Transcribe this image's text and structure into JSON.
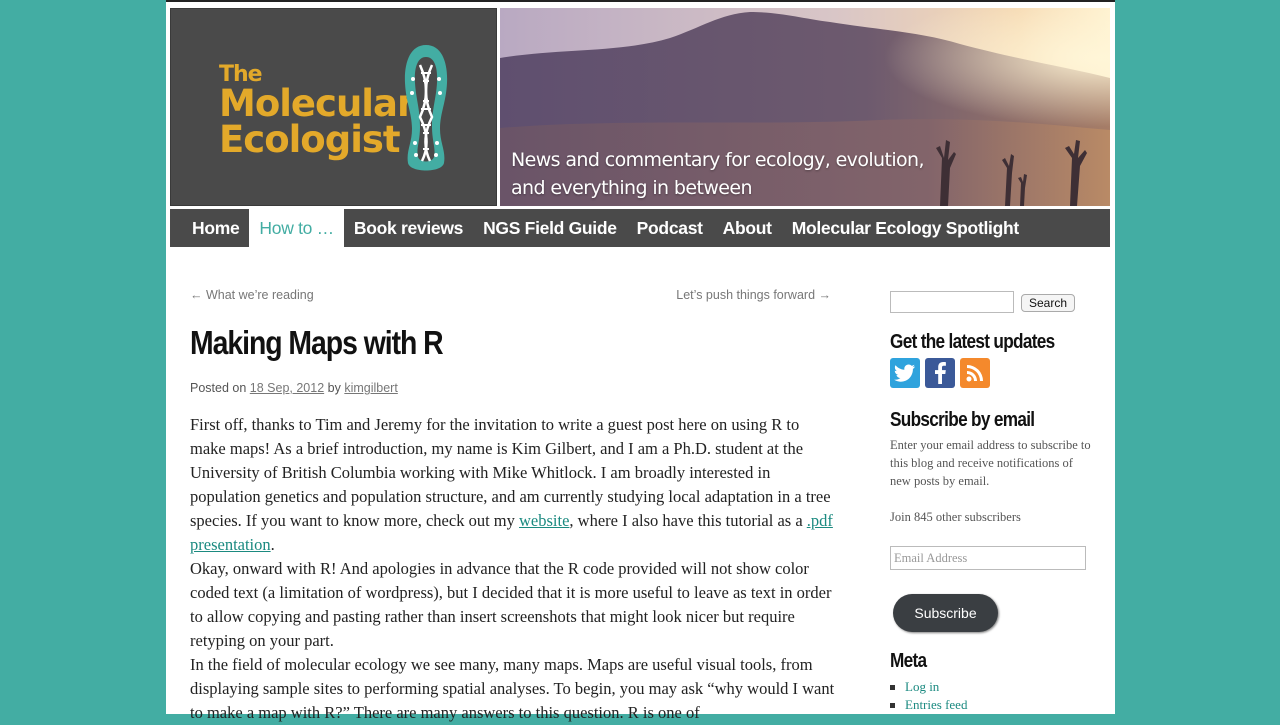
{
  "site": {
    "logo_line1": "The",
    "logo_line2": "Molecular",
    "logo_line3": "Ecologist",
    "tagline_line1": "News and commentary for ecology, evolution,",
    "tagline_line2": "and everything in between"
  },
  "nav": {
    "items": [
      "Home",
      "How to …",
      "Book reviews",
      "NGS Field Guide",
      "Podcast",
      "About",
      "Molecular Ecology Spotlight"
    ],
    "active": "How to …"
  },
  "post_nav": {
    "prev": "← What we’re reading",
    "next": "Let’s push things forward →"
  },
  "post": {
    "title": "Making Maps with R",
    "posted_on": "Posted on",
    "date": "18 Sep, 2012",
    "by": "by",
    "author": "kimgilbert",
    "p1_a": "First off, thanks to Tim and Jeremy for the invitation to write a guest post here on using R to make maps! As a brief introduction, my name is Kim Gilbert, and I am a Ph.D. student at the University of British Columbia working with Mike Whitlock. I am broadly interested in population genetics and population structure, and am currently studying local adaptation in a tree species. If you want to know more, check out my ",
    "p1_link1": "website",
    "p1_b": ", where I also have this tutorial as a ",
    "p1_link2": ".pdf presentation",
    "p1_c": ".",
    "p2": "Okay, onward with R! And apologies in advance that the R code provided will not show color coded text (a limitation of wordpress), but I decided that it is more useful to leave as text in order to allow copying and pasting rather than insert screenshots that might look nicer but require retyping on your part.",
    "p3": "In the field of molecular ecology we see many, many maps. Maps are useful visual tools, from displaying sample sites to performing spatial analyses. To begin, you may ask “why would I want to make a map with R?” There are many answers to this question. R is one of"
  },
  "sidebar": {
    "search_button": "Search",
    "updates_heading": "Get the latest updates",
    "social_icons": [
      "twitter-icon",
      "facebook-icon",
      "rss-icon"
    ],
    "subscribe_heading": "Subscribe by email",
    "subscribe_text": "Enter your email address to subscribe to this blog and receive notifications of new posts by email.",
    "subscribers": "Join 845 other subscribers",
    "email_placeholder": "Email Address",
    "subscribe_button": "Subscribe",
    "meta_heading": "Meta",
    "meta_links": [
      "Log in",
      "Entries feed"
    ]
  },
  "colors": {
    "accent": "#43ada3",
    "logo_gold": "#e3a92a",
    "nav_bg": "#4a4a4a",
    "link": "#1b8a80",
    "twitter": "#2fa3dd",
    "facebook": "#3b5998",
    "rss": "#f4892c"
  }
}
